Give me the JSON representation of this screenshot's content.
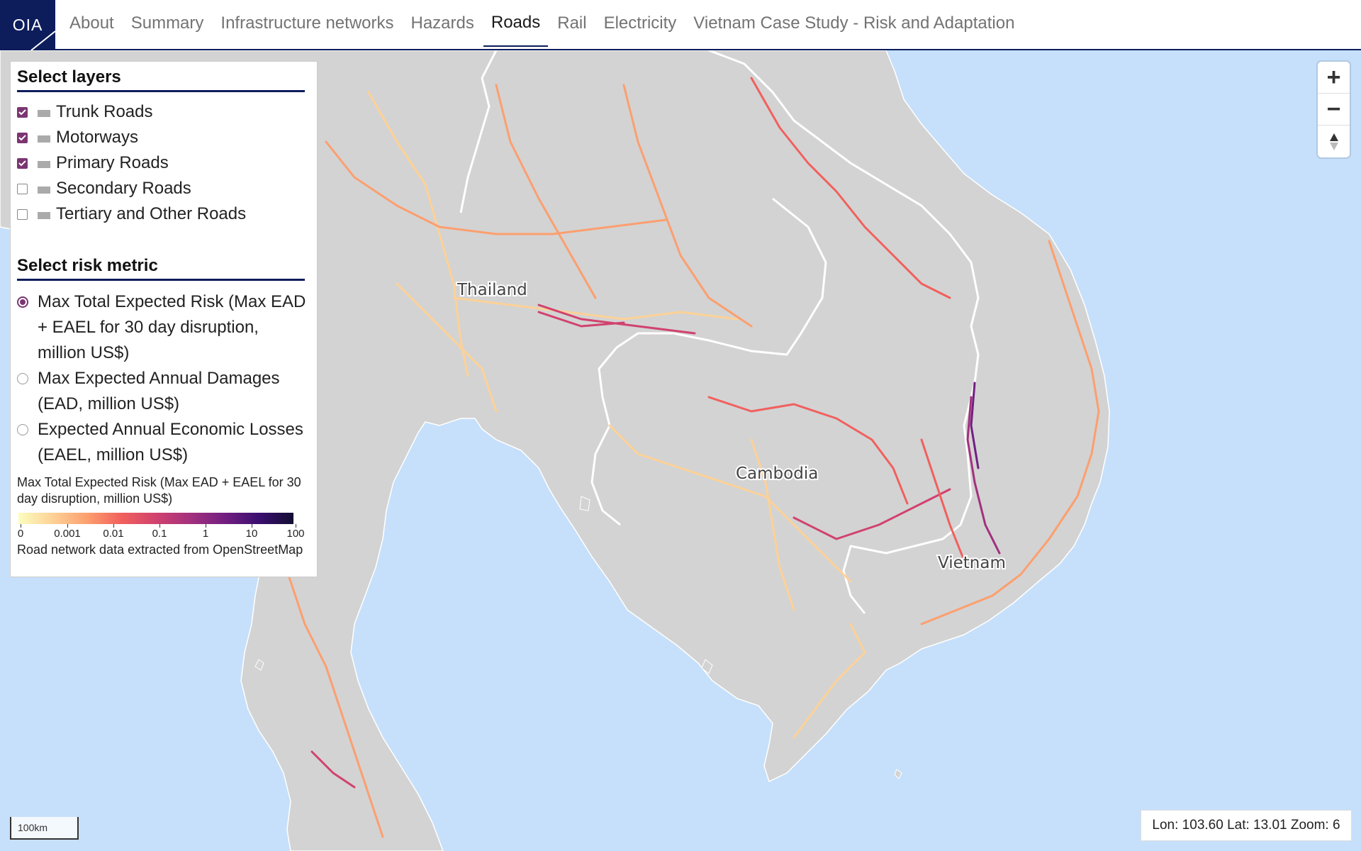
{
  "brand": {
    "logo_text": "OIA"
  },
  "nav": {
    "tabs": [
      {
        "label": "About"
      },
      {
        "label": "Summary"
      },
      {
        "label": "Infrastructure networks"
      },
      {
        "label": "Hazards"
      },
      {
        "label": "Roads",
        "active": true
      },
      {
        "label": "Rail"
      },
      {
        "label": "Electricity"
      },
      {
        "label": "Vietnam Case Study - Risk and Adaptation"
      }
    ]
  },
  "layers": {
    "title": "Select layers",
    "items": [
      {
        "label": "Trunk Roads",
        "checked": true
      },
      {
        "label": "Motorways",
        "checked": true
      },
      {
        "label": "Primary Roads",
        "checked": true
      },
      {
        "label": "Secondary Roads",
        "checked": false
      },
      {
        "label": "Tertiary and Other Roads",
        "checked": false
      }
    ]
  },
  "risk": {
    "title": "Select risk metric",
    "options": [
      {
        "label": "Max Total Expected Risk (Max EAD + EAEL for 30 day disruption, million US$)",
        "selected": true
      },
      {
        "label": "Max Expected Annual Damages (EAD, million US$)",
        "selected": false
      },
      {
        "label": "Expected Annual Economic Losses (EAEL, million US$)",
        "selected": false
      }
    ]
  },
  "legend": {
    "title": "Max Total Expected Risk (Max EAD + EAEL for 30 day disruption, million US$)",
    "ticks": [
      "0",
      "0.001",
      "0.01",
      "0.1",
      "1",
      "10",
      "100"
    ],
    "note": "Road network data extracted from OpenStreetMap",
    "colormap": [
      "#fcfdbf",
      "#fdd196",
      "#fc9f6f",
      "#f1605d",
      "#d1426e",
      "#a3307e",
      "#721f81",
      "#3b0f70",
      "#120d31"
    ]
  },
  "map": {
    "labels": {
      "thailand": "Thailand",
      "cambodia": "Cambodia",
      "vietnam": "Vietnam"
    },
    "scale_label": "100km",
    "status": "Lon: 103.60 Lat: 13.01 Zoom: 6",
    "colors": {
      "water": "#c6e0fb",
      "land": "#d3d3d3",
      "border": "#ffffff"
    }
  },
  "controls": {
    "zoom_in": "+",
    "zoom_out": "−",
    "compass": "▲"
  }
}
